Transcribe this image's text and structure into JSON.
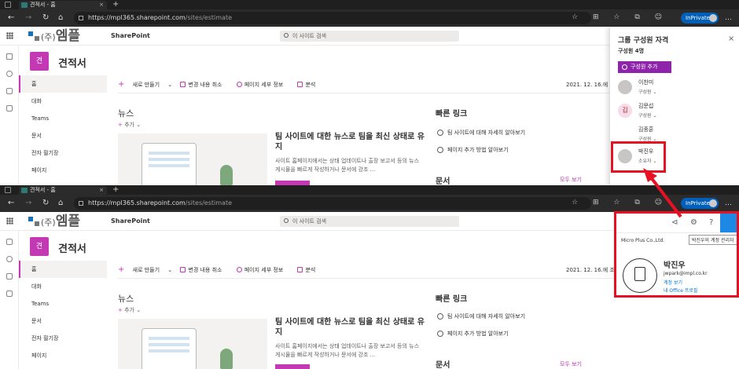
{
  "browser": {
    "tab_title": "견적서 - 홈",
    "tab_close": "×",
    "new_tab": "+",
    "url_host": "https://mpl365.sharepoint.com",
    "url_path": "/sites/estimate",
    "inprivate_label": "InPrivate",
    "more": "…",
    "nav": {
      "back": "←",
      "forward": "→",
      "refresh": "↻",
      "home": "⌂"
    },
    "toolbar_icons": "☆ ⊞ ☆ ⧉ ☺"
  },
  "sharepoint": {
    "logo_text": "엠플",
    "logo_company": "(주)",
    "app_name": "SharePoint",
    "search_placeholder": "이 사이트 검색"
  },
  "site": {
    "icon_letter": "견",
    "name": "견적서",
    "nav": [
      "홈",
      "대화",
      "Teams",
      "문서",
      "전자 필기장",
      "페이지"
    ]
  },
  "commandbar": {
    "new": "새로 만들기",
    "discard": "변경 내용 취소",
    "page_details": "페이지 세부 정보",
    "analytics": "분석",
    "date_top": "2021. 12. 16.에",
    "date_bottom": "2021. 12. 16.에 조안"
  },
  "news": {
    "heading": "뉴스",
    "add": "추가",
    "title": "팀 사이트에 대한 뉴스로 팀을 최신 상태로 유지",
    "desc": "사이트 홈페이지에서는 상태 업데이트나 출장 보고서 등의 뉴스 게시물을 빠르게 작성하거나 문서에 강조 ..."
  },
  "quicklinks": {
    "heading": "빠른 링크",
    "items": [
      "팀 사이트에 대해 자세히 알아보기",
      "페이지 추가 방법 알아보기"
    ]
  },
  "documents": {
    "heading": "문서",
    "see_all": "모두 보기"
  },
  "group_panel": {
    "title": "그룹 구성원 자격",
    "close": "×",
    "count": "구성원 4명",
    "add_button": "구성원 추가",
    "members": [
      {
        "name": "이찬미",
        "role": "구성원",
        "initial": ""
      },
      {
        "name": "김문섭",
        "role": "구성원",
        "initial": "김"
      },
      {
        "name": "김종훈",
        "role": "구성원",
        "initial": ""
      },
      {
        "name": "박진우",
        "role": "소유자",
        "initial": ""
      }
    ]
  },
  "account": {
    "org": "Micro Plus Co.,Ltd.",
    "tooltip": "박진우의 계정 관리자",
    "name": "박진우",
    "email": "jwpark@impl.co.kr",
    "view_account": "계정 보기",
    "office_profile": "내 Office 프로필",
    "help_icon_text": "?"
  },
  "colors": {
    "site_accent": "#c239b3",
    "add_button": "#8e24aa",
    "highlight": "#e81123",
    "inprivate": "#005fb8"
  }
}
